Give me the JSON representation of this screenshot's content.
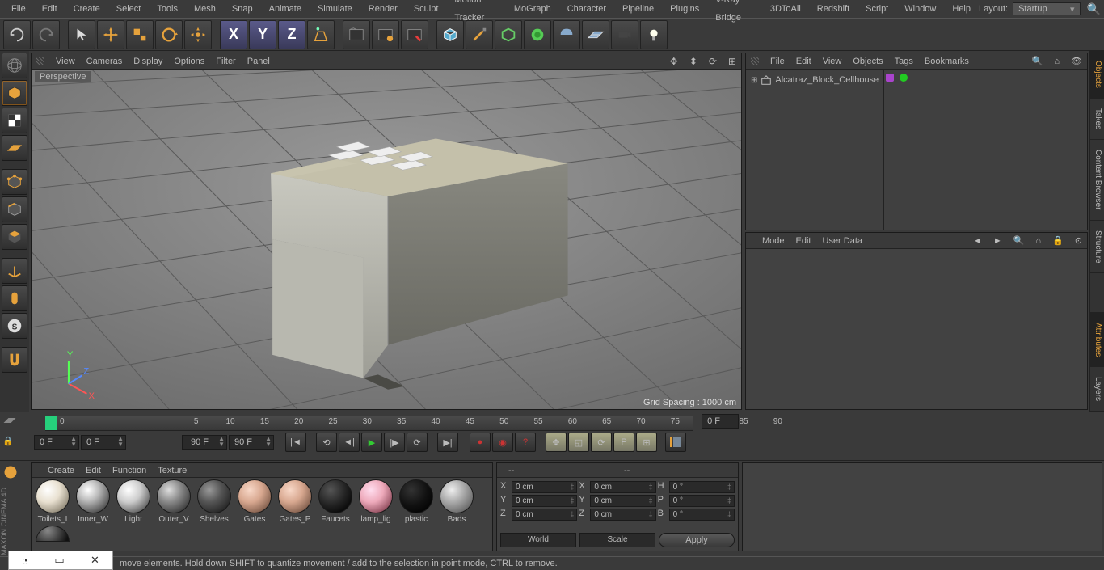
{
  "menu": [
    "File",
    "Edit",
    "Create",
    "Select",
    "Tools",
    "Mesh",
    "Snap",
    "Animate",
    "Simulate",
    "Render",
    "Sculpt",
    "Motion Tracker",
    "MoGraph",
    "Character",
    "Pipeline",
    "Plugins",
    "V-Ray Bridge",
    "3DToAll",
    "Redshift",
    "Script",
    "Window",
    "Help"
  ],
  "layout_label": "Layout:",
  "layout_value": "Startup",
  "viewport_menu": [
    "View",
    "Cameras",
    "Display",
    "Options",
    "Filter",
    "Panel"
  ],
  "viewport_label": "Perspective",
  "grid_spacing": "Grid Spacing : 1000 cm",
  "objects_menu": [
    "File",
    "Edit",
    "View",
    "Objects",
    "Tags",
    "Bookmarks"
  ],
  "object_name": "Alcatraz_Block_Cellhouse",
  "attr_menu": [
    "Mode",
    "Edit",
    "User Data"
  ],
  "right_tabs": [
    "Objects",
    "Takes",
    "Content Browser",
    "Structure"
  ],
  "right_tabs2": [
    "Attributes",
    "Layers"
  ],
  "timeline": {
    "ticks": [
      0,
      5,
      10,
      15,
      20,
      25,
      30,
      35,
      40,
      45,
      50,
      55,
      60,
      65,
      70,
      75,
      80,
      85,
      90
    ],
    "cur": "0 F",
    "start": "0 F",
    "end": "90 F",
    "end2": "90 F",
    "cur_right": "0 F"
  },
  "materials_menu": [
    "Create",
    "Edit",
    "Function",
    "Texture"
  ],
  "materials": [
    "Toilets_I",
    "Inner_W",
    "Light",
    "Outer_V",
    "Shelves",
    "Gates",
    "Gates_P",
    "Faucets",
    "lamp_lig",
    "plastic",
    "Bads"
  ],
  "coords_title": "--",
  "coords": {
    "X": "0 cm",
    "Y": "0 cm",
    "Z": "0 cm",
    "X2": "0 cm",
    "Y2": "0 cm",
    "Z2": "0 cm",
    "H": "0 °",
    "P": "0 °",
    "B": "0 °"
  },
  "coord_mode1": "World",
  "coord_mode2": "Scale",
  "apply": "Apply",
  "status": "move elements. Hold down SHIFT to quantize movement / add to the selection in point mode, CTRL to remove.",
  "app_logo": "MAXON CINEMA 4D"
}
